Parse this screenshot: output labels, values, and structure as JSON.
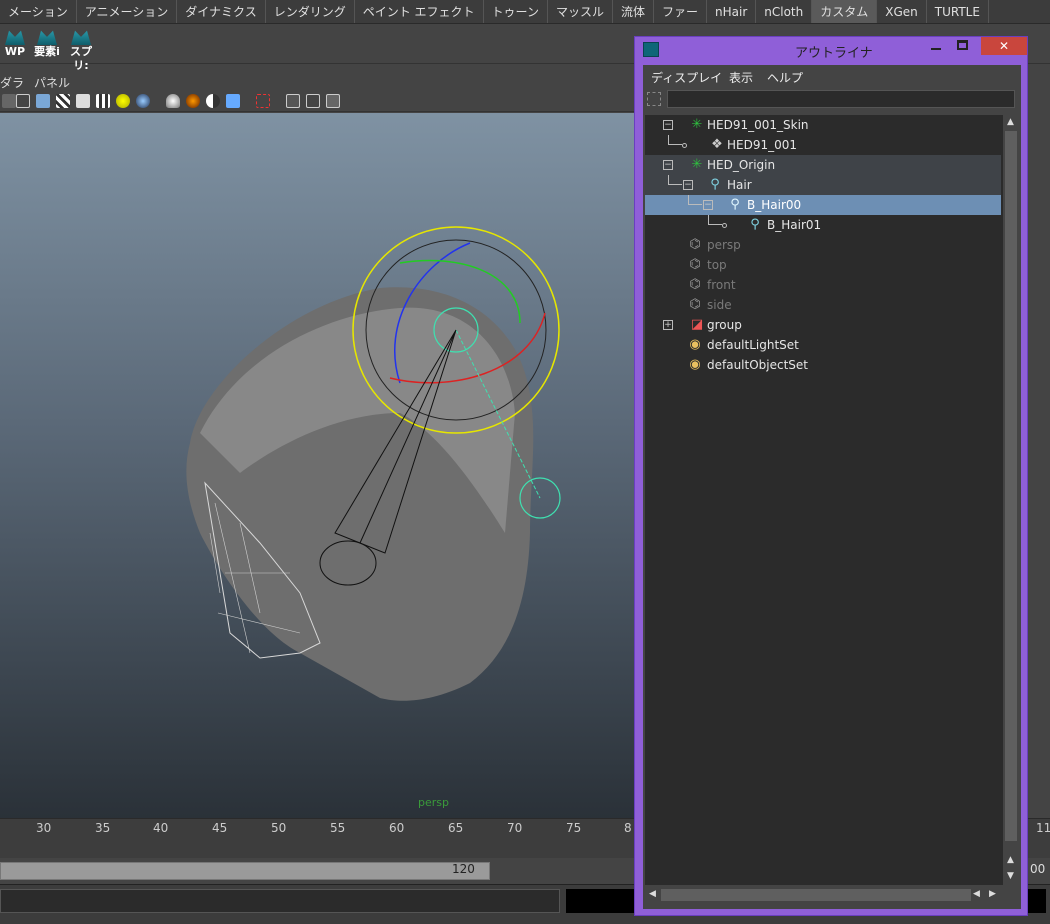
{
  "menu_tabs": [
    "メーション",
    "アニメーション",
    "ダイナミクス",
    "レンダリング",
    "ペイント エフェクト",
    "トゥーン",
    "マッスル",
    "流体",
    "ファー",
    "nHair",
    "nCloth",
    "カスタム",
    "XGen",
    "TURTLE"
  ],
  "active_tab": "カスタム",
  "shelf": {
    "buttons": [
      "WP",
      "要素i",
      "スプリ:"
    ]
  },
  "viewport": {
    "menu": [
      "ダラ",
      "パネル"
    ],
    "camera_label": "persp"
  },
  "timeline": {
    "ticks": [
      "30",
      "35",
      "40",
      "45",
      "50",
      "55",
      "60",
      "65",
      "70",
      "75",
      "8",
      "11"
    ]
  },
  "range": {
    "end_value": "120",
    "right_value": "00"
  },
  "outliner": {
    "title": "アウトライナ",
    "close_glyph": "✕",
    "menu": [
      "ディスプレイ",
      "表示",
      "ヘルプ"
    ],
    "items": [
      {
        "label": "HED91_001_Skin",
        "icon": "skin-cluster-icon",
        "expander": "−"
      },
      {
        "label": "HED91_001",
        "icon": "mesh-icon"
      },
      {
        "label": "HED_Origin",
        "icon": "skin-cluster-icon",
        "expander": "−"
      },
      {
        "label": "Hair",
        "icon": "joint-icon",
        "expander": "−"
      },
      {
        "label": "B_Hair00",
        "icon": "joint-icon",
        "expander": "−"
      },
      {
        "label": "B_Hair01",
        "icon": "joint-icon"
      },
      {
        "label": "persp",
        "icon": "camera-icon"
      },
      {
        "label": "top",
        "icon": "camera-icon"
      },
      {
        "label": "front",
        "icon": "camera-icon"
      },
      {
        "label": "side",
        "icon": "camera-icon"
      },
      {
        "label": "group",
        "icon": "group-icon",
        "expander": "+"
      },
      {
        "label": "defaultLightSet",
        "icon": "set-icon"
      },
      {
        "label": "defaultObjectSet",
        "icon": "set-icon"
      }
    ],
    "selected_item": "B_Hair00"
  },
  "colors": {
    "outliner_border": "#8f5fd8",
    "selection": "#6d8fb4",
    "close_button": "#c9463d",
    "joint": "#7fd1e0",
    "skin": "#2fbf3f"
  }
}
